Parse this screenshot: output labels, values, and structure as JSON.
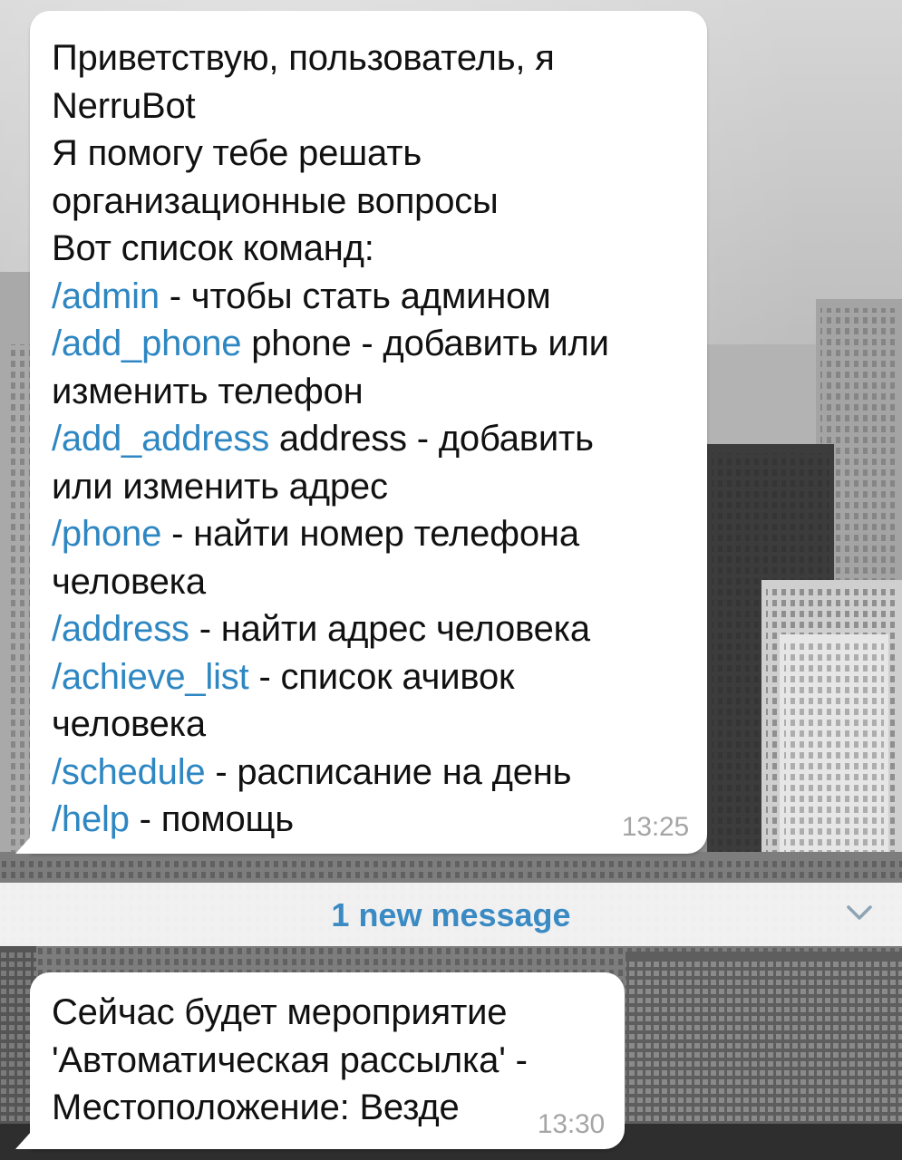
{
  "chat": {
    "messages": [
      {
        "lines": [
          [
            {
              "text": "Приветствую, пользователь, я",
              "type": "text"
            }
          ],
          [
            {
              "text": "NerruBot",
              "type": "text"
            }
          ],
          [
            {
              "text": "Я помогу тебе решать",
              "type": "text"
            }
          ],
          [
            {
              "text": "организационные вопросы",
              "type": "text"
            }
          ],
          [
            {
              "text": "Вот список команд:",
              "type": "text"
            }
          ],
          [
            {
              "text": "/admin",
              "type": "command"
            },
            {
              "text": " - чтобы стать админом",
              "type": "text"
            }
          ],
          [
            {
              "text": "/add_phone",
              "type": "command"
            },
            {
              "text": " phone - добавить или",
              "type": "text"
            }
          ],
          [
            {
              "text": "изменить телефон",
              "type": "text"
            }
          ],
          [
            {
              "text": "/add_address",
              "type": "command"
            },
            {
              "text": " address - добавить",
              "type": "text"
            }
          ],
          [
            {
              "text": "или изменить адрес",
              "type": "text"
            }
          ],
          [
            {
              "text": "/phone",
              "type": "command"
            },
            {
              "text": " - найти номер телефона",
              "type": "text"
            }
          ],
          [
            {
              "text": "человека",
              "type": "text"
            }
          ],
          [
            {
              "text": "/address",
              "type": "command"
            },
            {
              "text": " - найти адрес человека",
              "type": "text"
            }
          ],
          [
            {
              "text": "/achieve_list",
              "type": "command"
            },
            {
              "text": " - список ачивок",
              "type": "text"
            }
          ],
          [
            {
              "text": "человека",
              "type": "text"
            }
          ],
          [
            {
              "text": "/schedule",
              "type": "command"
            },
            {
              "text": " - расписание на день",
              "type": "text"
            }
          ],
          [
            {
              "text": "/help",
              "type": "command"
            },
            {
              "text": " - помощь",
              "type": "text"
            }
          ]
        ],
        "time": "13:25"
      },
      {
        "lines": [
          [
            {
              "text": "Сейчас будет мероприятие",
              "type": "text"
            }
          ],
          [
            {
              "text": "'Автоматическая рассылка' -",
              "type": "text"
            }
          ],
          [
            {
              "text": "Местоположение: Везде",
              "type": "text"
            }
          ]
        ],
        "time": "13:30"
      }
    ],
    "new_messages_label": "1 new message"
  },
  "icons": {
    "scroll_down": "chevron-down-icon"
  },
  "colors": {
    "command_link": "#2e87c2",
    "new_message_label": "#3a8ac4",
    "timestamp": "#a5a5a5",
    "bubble_background": "#ffffff"
  }
}
